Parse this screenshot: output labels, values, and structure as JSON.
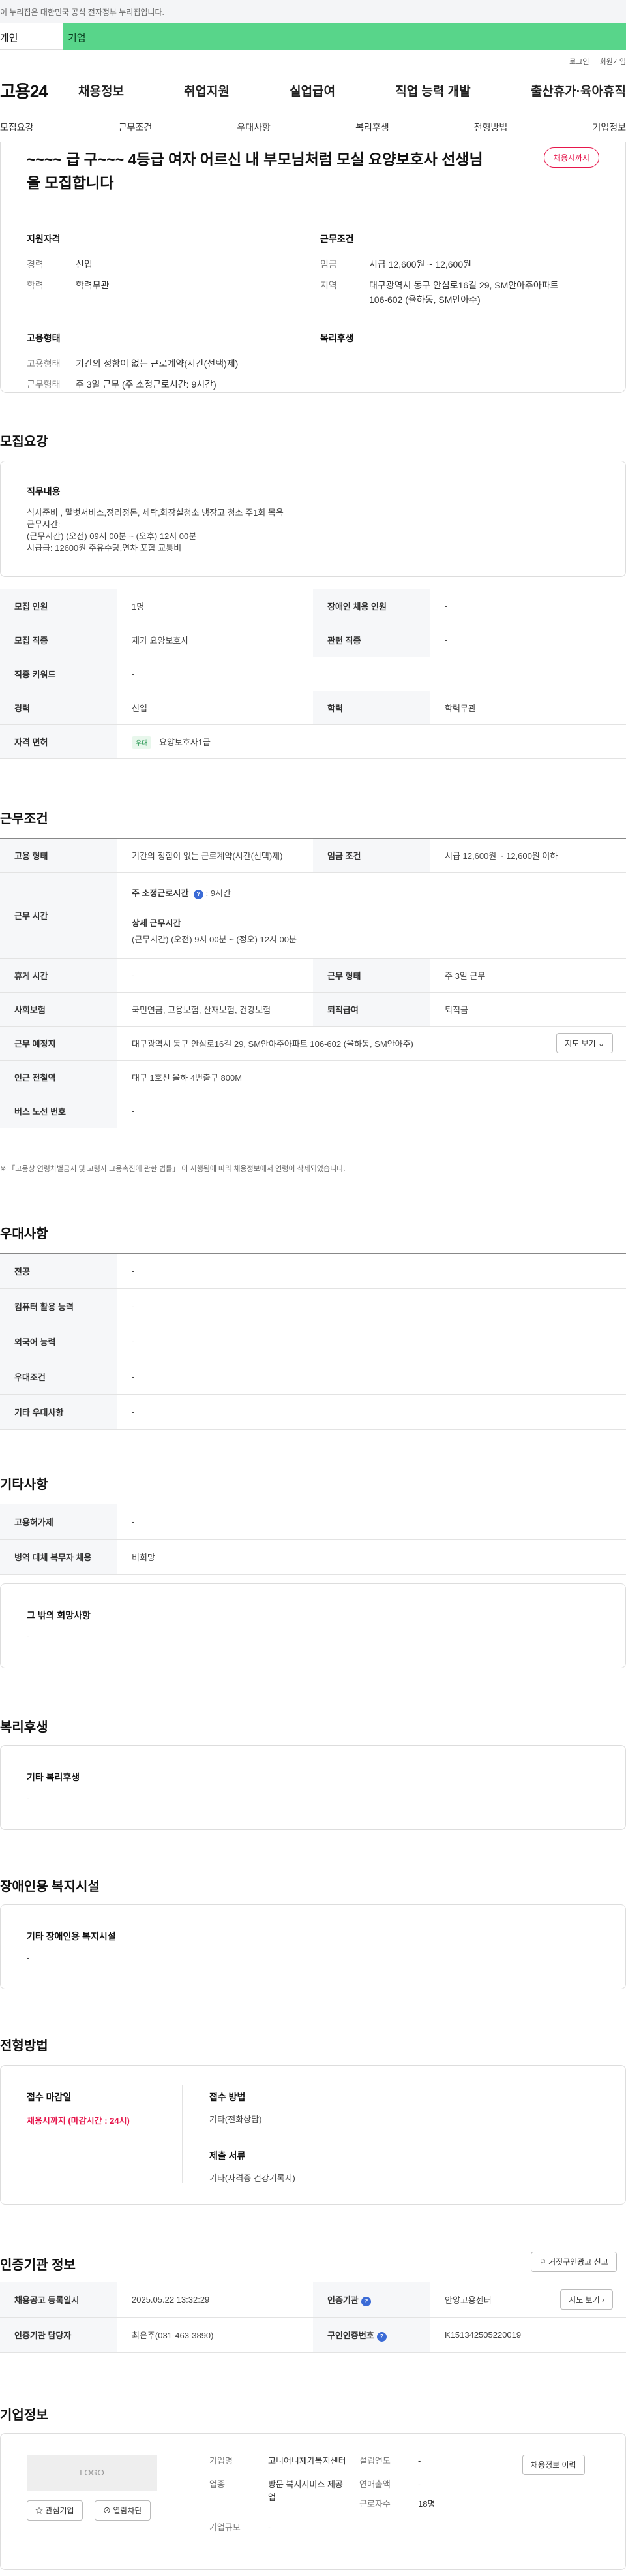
{
  "gov_banner": "이 누리집은 대한민국 공식 전자정부 누리집입니다.",
  "user_tabs": {
    "person": "개인",
    "company": "기업"
  },
  "util_links": [
    "로그인",
    "회원가입"
  ],
  "logo": "고용24",
  "gnb": [
    "채용정보",
    "취업지원",
    "실업급여",
    "직업 능력 개발",
    "출산휴가·육아휴직"
  ],
  "subnav": [
    "모집요강",
    "근무조건",
    "우대사항",
    "복리후생",
    "전형방법",
    "기업정보"
  ],
  "summary": {
    "title": "~~~~ 급 구~~~ 4등급 여자 어르신 내 부모님처럼 모실 요양보호사 선생님을 모집합니다",
    "status": "채용시까지",
    "qualification": {
      "heading": "지원자격",
      "career_label": "경력",
      "career": "신입",
      "education_label": "학력",
      "education": "학력무관"
    },
    "conditions": {
      "heading": "근무조건",
      "wage_label": "임금",
      "wage": "시급 12,600원 ~ 12,600원",
      "region_label": "지역",
      "region": "대구광역시 동구 안심로16길 29, SM안아주아파트 106-602 (율하동, SM안아주)"
    },
    "employment": {
      "heading": "고용형태",
      "type_label": "고용형태",
      "type": "기간의 정함이 없는 근로계약(시간(선택)제)",
      "days_label": "근무형태",
      "days": "주 3일 근무 (주 소정근로시간: 9시간)"
    },
    "welfare": {
      "heading": "복리후생"
    }
  },
  "recruit": {
    "title": "모집요강",
    "duty_title": "직무내용",
    "duty_text": "식사준비 , 말벗서비스,정리정돈, 세탁,화장실청소 냉장고 청소 주1회 목욕\n근무시간:\n(근무시간) (오전) 09시 00분 ~ (오후) 12시 00분\n시급급: 12600원 주유수당,연차 포함 교통비",
    "headcount_label": "모집 인원",
    "headcount": "1명",
    "disabled_label": "장애인 채용 인원",
    "disabled": "-",
    "job_label": "모집 직종",
    "job": "재가 요양보호사",
    "related_label": "관련 직종",
    "related": "-",
    "keyword_label": "직종 키워드",
    "keyword": "-",
    "career_label": "경력",
    "career": "신입",
    "edu_label": "학력",
    "edu": "학력무관",
    "license_label": "자격 면허",
    "license_chip": "우대",
    "license": "요양보호사1급"
  },
  "work": {
    "title": "근무조건",
    "type_label": "고용 형태",
    "type": "기간의 정함이 없는 근로계약(시간(선택)제)",
    "wage_label": "임금 조건",
    "wage": "시급 12,600원 ~ 12,600원 이하",
    "hours_label": "근무 시간",
    "hours_weekly_label": "주 소정근로시간",
    "hours_weekly": ": 9시간",
    "hours_detail_label": "상세 근무시간",
    "hours_detail": "(근무시간) (오전) 9시 00분 ~ (정오) 12시 00분",
    "rest_label": "휴게 시간",
    "rest": "-",
    "form_label": "근무 형태",
    "form": "주 3일 근무",
    "insurance_label": "사회보험",
    "insurance": "국민연금, 고용보험, 산재보험, 건강보험",
    "severance_label": "퇴직급여",
    "severance": "퇴직금",
    "place_label": "근무 예정지",
    "place": "대구광역시 동구 안심로16길 29, SM안아주아파트 106-602 (율하동, SM안아주)",
    "map_button": "지도 보기",
    "station_label": "인근 전철역",
    "station": "대구 1호선 율하 4번출구 800M",
    "bus_label": "버스 노선 번호",
    "bus": "-",
    "note": "※ 「고용상 연령차별금지 및 고령자 고용촉진에 관한 법률」 이 시행됨에 따라 채용정보에서 연령이 삭제되었습니다."
  },
  "preference": {
    "title": "우대사항",
    "rows": [
      {
        "label": "전공",
        "value": "-"
      },
      {
        "label": "컴퓨터 활용 능력",
        "value": "-"
      },
      {
        "label": "외국어 능력",
        "value": "-"
      },
      {
        "label": "우대조건",
        "value": "-"
      },
      {
        "label": "기타 우대사항",
        "value": "-"
      }
    ]
  },
  "etc": {
    "title": "기타사항",
    "insurance_label": "고용허가제",
    "insurance": "-",
    "military_label": "병역 대체 복무자 채용",
    "military": "비희망",
    "hope_title": "그 밖의 희망사항",
    "hope": "-"
  },
  "welfare": {
    "title": "복리후생",
    "box_title": "기타 복리후생",
    "box_value": "-"
  },
  "disabled_facility": {
    "title": "장애인용 복지시설",
    "box_title": "기타 장애인용 복지시설",
    "box_value": "-"
  },
  "selection": {
    "title": "전형방법",
    "deadline_label": "접수 마감일",
    "deadline": "채용시까지 (마감시간 : 24시)",
    "method_label": "접수 방법",
    "method": "기타(전화상담)",
    "docs_label": "제출 서류",
    "docs": "기타(자격증 건강기록지)"
  },
  "agency": {
    "title": "인증기관 정보",
    "report_button": "거짓구인광고 신고",
    "reg_date_label": "채용공고 등록일시",
    "reg_date": "2025.05.22 13:32:29",
    "agency_label": "인증기관",
    "agency": "안양고용센터",
    "manager_label": "인증기관 담당자",
    "manager": "최은주(031-463-3890)",
    "number_label": "구인인증번호",
    "number": "K151342505220019",
    "map_button": "지도 보기"
  },
  "company": {
    "title": "기업정보",
    "logo_text": "LOGO",
    "fav_button": "관심기업",
    "block_button": "열람차단",
    "name_label": "기업명",
    "name": "고니어니재가복지센터",
    "industry_label": "업종",
    "industry": "방문 복지서비스 제공업",
    "size_label": "기업규모",
    "size": "-",
    "founded_label": "설립연도",
    "founded": "-",
    "sales_label": "연매출액",
    "sales": "-",
    "employees_label": "근로자수",
    "employees": "18명",
    "history_button": "채용정보 이력"
  }
}
